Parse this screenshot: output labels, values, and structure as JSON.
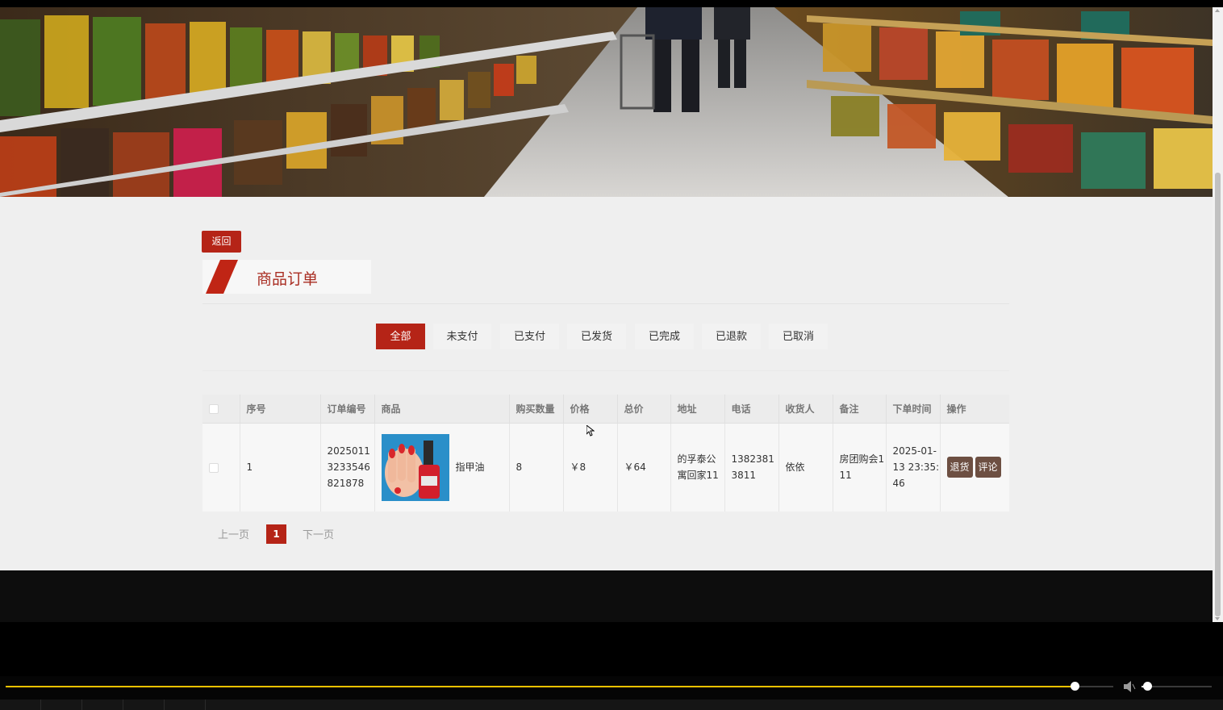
{
  "back_button": {
    "label": "返回"
  },
  "section_title": "商品订单",
  "filter_tabs": [
    {
      "label": "全部",
      "active": true
    },
    {
      "label": "未支付",
      "active": false
    },
    {
      "label": "已支付",
      "active": false
    },
    {
      "label": "已发货",
      "active": false
    },
    {
      "label": "已完成",
      "active": false
    },
    {
      "label": "已退款",
      "active": false
    },
    {
      "label": "已取消",
      "active": false
    }
  ],
  "table": {
    "headers": [
      "序号",
      "订单编号",
      "商品",
      "购买数量",
      "价格",
      "总价",
      "地址",
      "电话",
      "收货人",
      "备注",
      "下单时间",
      "操作"
    ],
    "rows": [
      {
        "index": "1",
        "order_no": "20250113233546821878",
        "product_name": "指甲油",
        "product_image": "nail-polish-icon",
        "quantity": "8",
        "price": "￥8",
        "total": "￥64",
        "address": "的孚泰公寓回家11",
        "phone": "13823813811",
        "receiver": "依依",
        "remark": "房团购会111",
        "order_time": "2025-01-13 23:35:46",
        "actions": [
          "退货",
          "评论"
        ]
      }
    ]
  },
  "pagination": {
    "prev": "上一页",
    "current": "1",
    "next": "下一页"
  },
  "colors": {
    "brand_red": "#b52417",
    "action_brown": "#6d4f42",
    "progress_yellow": "#f0c200"
  },
  "player": {
    "progress": 0.965,
    "volume": 0.08
  }
}
